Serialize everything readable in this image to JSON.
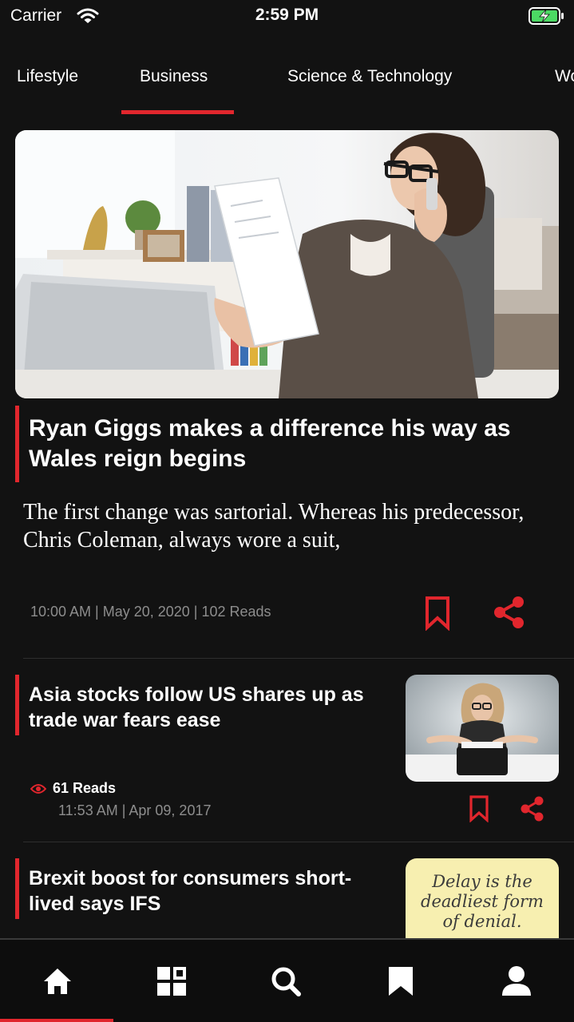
{
  "status_bar": {
    "carrier": "Carrier",
    "time": "2:59 PM"
  },
  "tabs": [
    {
      "label": "Lifestyle",
      "active": false
    },
    {
      "label": "Business",
      "active": true
    },
    {
      "label": "Science & Technology",
      "active": false
    },
    {
      "label": "Wo",
      "active": false
    }
  ],
  "featured": {
    "title": "Ryan Giggs makes a difference his way as Wales reign begins",
    "excerpt": "The first change was sartorial. Whereas his predecessor, Chris Coleman, always wore a suit,",
    "meta": "10:00 AM | May 20, 2020 | 102 Reads",
    "image_icon": "woman-phone-office-photo"
  },
  "articles": [
    {
      "title": "Asia stocks follow US shares up as trade war fears ease",
      "reads": "61 Reads",
      "time": "11:53 AM | Apr 09, 2017",
      "thumb_icon": "woman-typewriter-photo"
    },
    {
      "title": "Brexit boost for consumers short-lived says IFS",
      "thumb_icon": "sticky-note-photo",
      "thumb_text": [
        "Delay is the",
        "deadliest form",
        "of denial."
      ]
    }
  ],
  "bottom_nav": [
    {
      "icon": "home-icon",
      "active": true
    },
    {
      "icon": "grid-icon",
      "active": false
    },
    {
      "icon": "search-icon",
      "active": false
    },
    {
      "icon": "bookmark-icon",
      "active": false
    },
    {
      "icon": "profile-icon",
      "active": false
    }
  ],
  "colors": {
    "accent": "#e1262d",
    "background": "#121212",
    "meta_text": "#8d8d8d"
  }
}
